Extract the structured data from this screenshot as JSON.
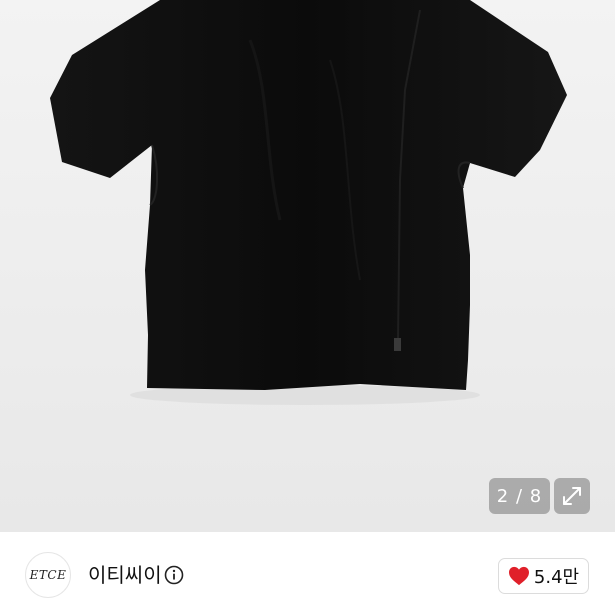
{
  "gallery": {
    "image_counter": "2 / 8",
    "image_icon": "black-tshirt-photo",
    "expand_icon": "expand-arrows-icon"
  },
  "seller": {
    "avatar_text": "ETCE",
    "name": "이티씨이",
    "info_icon": "info-circle-icon"
  },
  "like": {
    "icon": "heart-icon",
    "count": "5.4만",
    "heart_color": "#e0202a"
  }
}
